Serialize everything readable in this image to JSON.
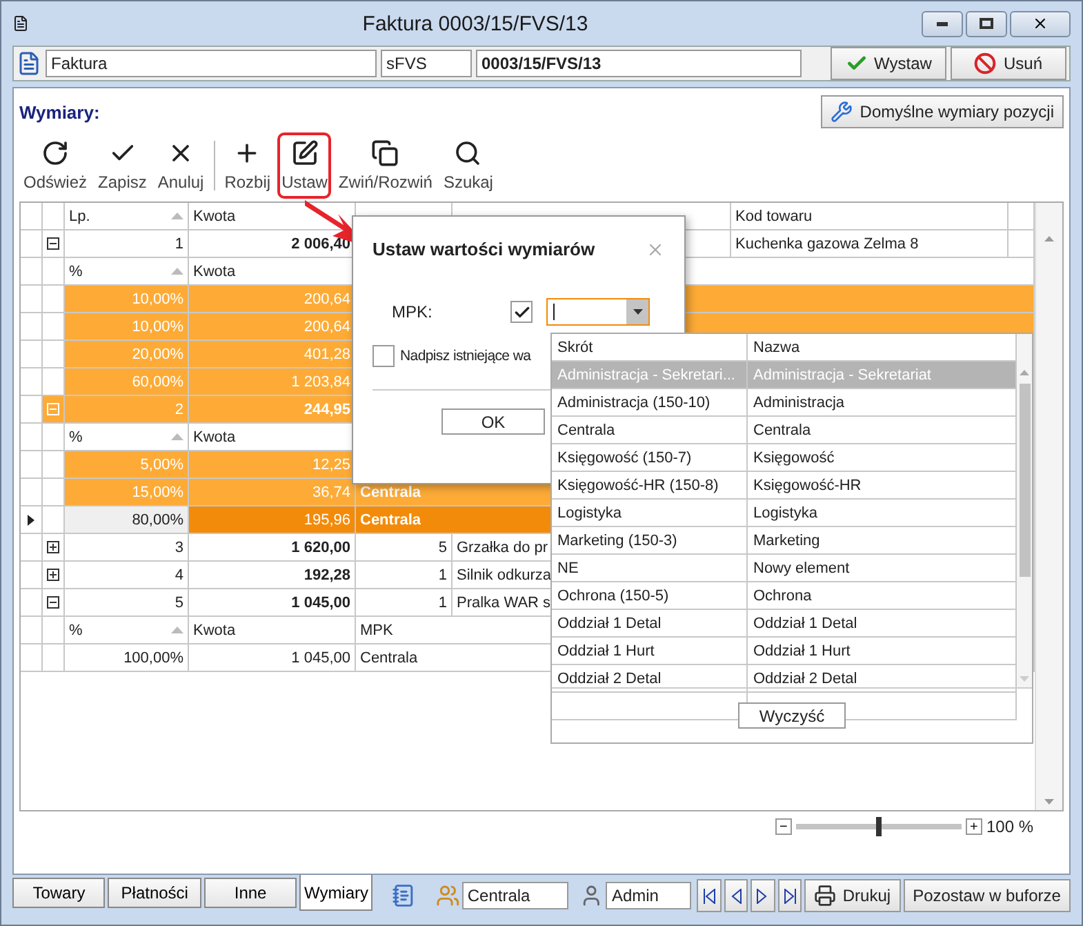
{
  "window": {
    "title": "Faktura 0003/15/FVS/13"
  },
  "header": {
    "doc_type": "Faktura",
    "series": "sFVS",
    "number": "0003/15/FVS/13",
    "buttons": [
      {
        "label": "Wystaw",
        "kind": "confirm"
      },
      {
        "label": "Usuń",
        "kind": "delete"
      }
    ]
  },
  "section": {
    "title": "Wymiary:",
    "default_button": "Domyślne wymiary pozycji"
  },
  "toolbar": {
    "groups": [
      [
        {
          "label": "Odśwież",
          "kind": "refresh",
          "highlighted": false
        },
        {
          "label": "Zapisz",
          "kind": "save",
          "highlighted": false
        },
        {
          "label": "Anuluj",
          "kind": "cancel",
          "highlighted": false
        }
      ],
      [
        {
          "label": "Rozbij",
          "kind": "split",
          "highlighted": false
        },
        {
          "label": "Ustaw",
          "kind": "edit",
          "highlighted": true
        },
        {
          "label": "Zwiń/Rozwiń",
          "kind": "collapse",
          "highlighted": false
        },
        {
          "label": "Szukaj",
          "kind": "search",
          "highlighted": false
        }
      ]
    ]
  },
  "grid": {
    "columns": {
      "lp": "Lp.",
      "kwota": "Kwota",
      "kod": "Kod towaru"
    },
    "rows": [
      {
        "lp": "1",
        "kwota": "2 006,40",
        "kod": "Kuchenka gazowa Zelma 8",
        "expanded": true,
        "selected": false,
        "split": {
          "pct": "%",
          "kwota": "Kwota",
          "rows": [
            {
              "pct": "10,00%",
              "kwota": "200,64",
              "selected": true,
              "focused": false
            },
            {
              "pct": "10,00%",
              "kwota": "200,64",
              "selected": true,
              "focused": false
            },
            {
              "pct": "20,00%",
              "kwota": "401,28",
              "selected": true,
              "focused": false
            },
            {
              "pct": "60,00%",
              "kwota": "1 203,84",
              "selected": true,
              "focused": false
            }
          ]
        }
      },
      {
        "lp": "2",
        "kwota": "244,95",
        "expanded": true,
        "selected": true,
        "split": {
          "pct": "%",
          "kwota": "Kwota",
          "rows": [
            {
              "pct": "5,00%",
              "kwota": "12,25",
              "selected": true,
              "focused": false
            },
            {
              "pct": "15,00%",
              "kwota": "36,74",
              "mpk": "Centrala",
              "selected": true,
              "focused": false
            },
            {
              "pct": "80,00%",
              "kwota": "195,96",
              "mpk": "Centrala",
              "selected": true,
              "focused": true
            }
          ]
        }
      },
      {
        "lp": "3",
        "kwota": "1 620,00",
        "qty": "5",
        "name": "Grzałka do pr",
        "expanded": false,
        "selected": false
      },
      {
        "lp": "4",
        "kwota": "192,28",
        "qty": "1",
        "name": "Silnik odkurza",
        "expanded": false,
        "selected": false
      },
      {
        "lp": "5",
        "kwota": "1 045,00",
        "qty": "1",
        "name": "Pralka WAR s",
        "expanded": true,
        "selected": false,
        "split": {
          "pct": "%",
          "kwota": "Kwota",
          "mpk": "MPK",
          "rows": [
            {
              "pct": "100,00%",
              "kwota": "1 045,00",
              "mpk": "Centrala",
              "selected": false,
              "focused": false
            }
          ]
        }
      }
    ]
  },
  "zoom": {
    "minus": "−",
    "plus": "+",
    "level": 0.5,
    "reading": "100 %"
  },
  "dialog": {
    "title": "Ustaw wartości wymiarów",
    "field": {
      "label": "MPK:",
      "checked": true
    },
    "overwrite": {
      "label": "Nadpisz istniejące wa",
      "checked": false
    },
    "ok": "OK"
  },
  "dropdown": {
    "columns": [
      "Skrót",
      "Nazwa"
    ],
    "rows": [
      {
        "code": "Administracja - Sekretari...",
        "name": "Administracja - Sekretariat",
        "selected": true
      },
      {
        "code": "Administracja (150-10)",
        "name": "Administracja",
        "selected": false
      },
      {
        "code": "Centrala",
        "name": "Centrala",
        "selected": false
      },
      {
        "code": "Księgowość (150-7)",
        "name": "Księgowość",
        "selected": false
      },
      {
        "code": "Księgowość-HR (150-8)",
        "name": "Księgowość-HR",
        "selected": false
      },
      {
        "code": "Logistyka",
        "name": "Logistyka",
        "selected": false
      },
      {
        "code": "Marketing (150-3)",
        "name": "Marketing",
        "selected": false
      },
      {
        "code": "NE",
        "name": "Nowy element",
        "selected": false
      },
      {
        "code": "Ochrona (150-5)",
        "name": "Ochrona",
        "selected": false
      },
      {
        "code": "Oddział 1 Detal",
        "name": "Oddział 1 Detal",
        "selected": false
      },
      {
        "code": "Oddział 1 Hurt",
        "name": "Oddział 1 Hurt",
        "selected": false
      },
      {
        "code": "Oddział 2 Detal",
        "name": "Oddział 2 Detal",
        "selected": false
      }
    ],
    "clear_button": "Wyczyść"
  },
  "bottom": {
    "tabs": [
      {
        "label": "Towary",
        "selected": false
      },
      {
        "label": "Płatności",
        "selected": false
      },
      {
        "label": "Inne",
        "selected": false
      },
      {
        "label": "Wymiary",
        "selected": true
      }
    ],
    "branch": "Centrala",
    "user": "Admin",
    "buttons": [
      {
        "label": "Drukuj",
        "kind": "print"
      },
      {
        "label": "Pozostaw w buforze",
        "kind": "plain"
      }
    ]
  }
}
